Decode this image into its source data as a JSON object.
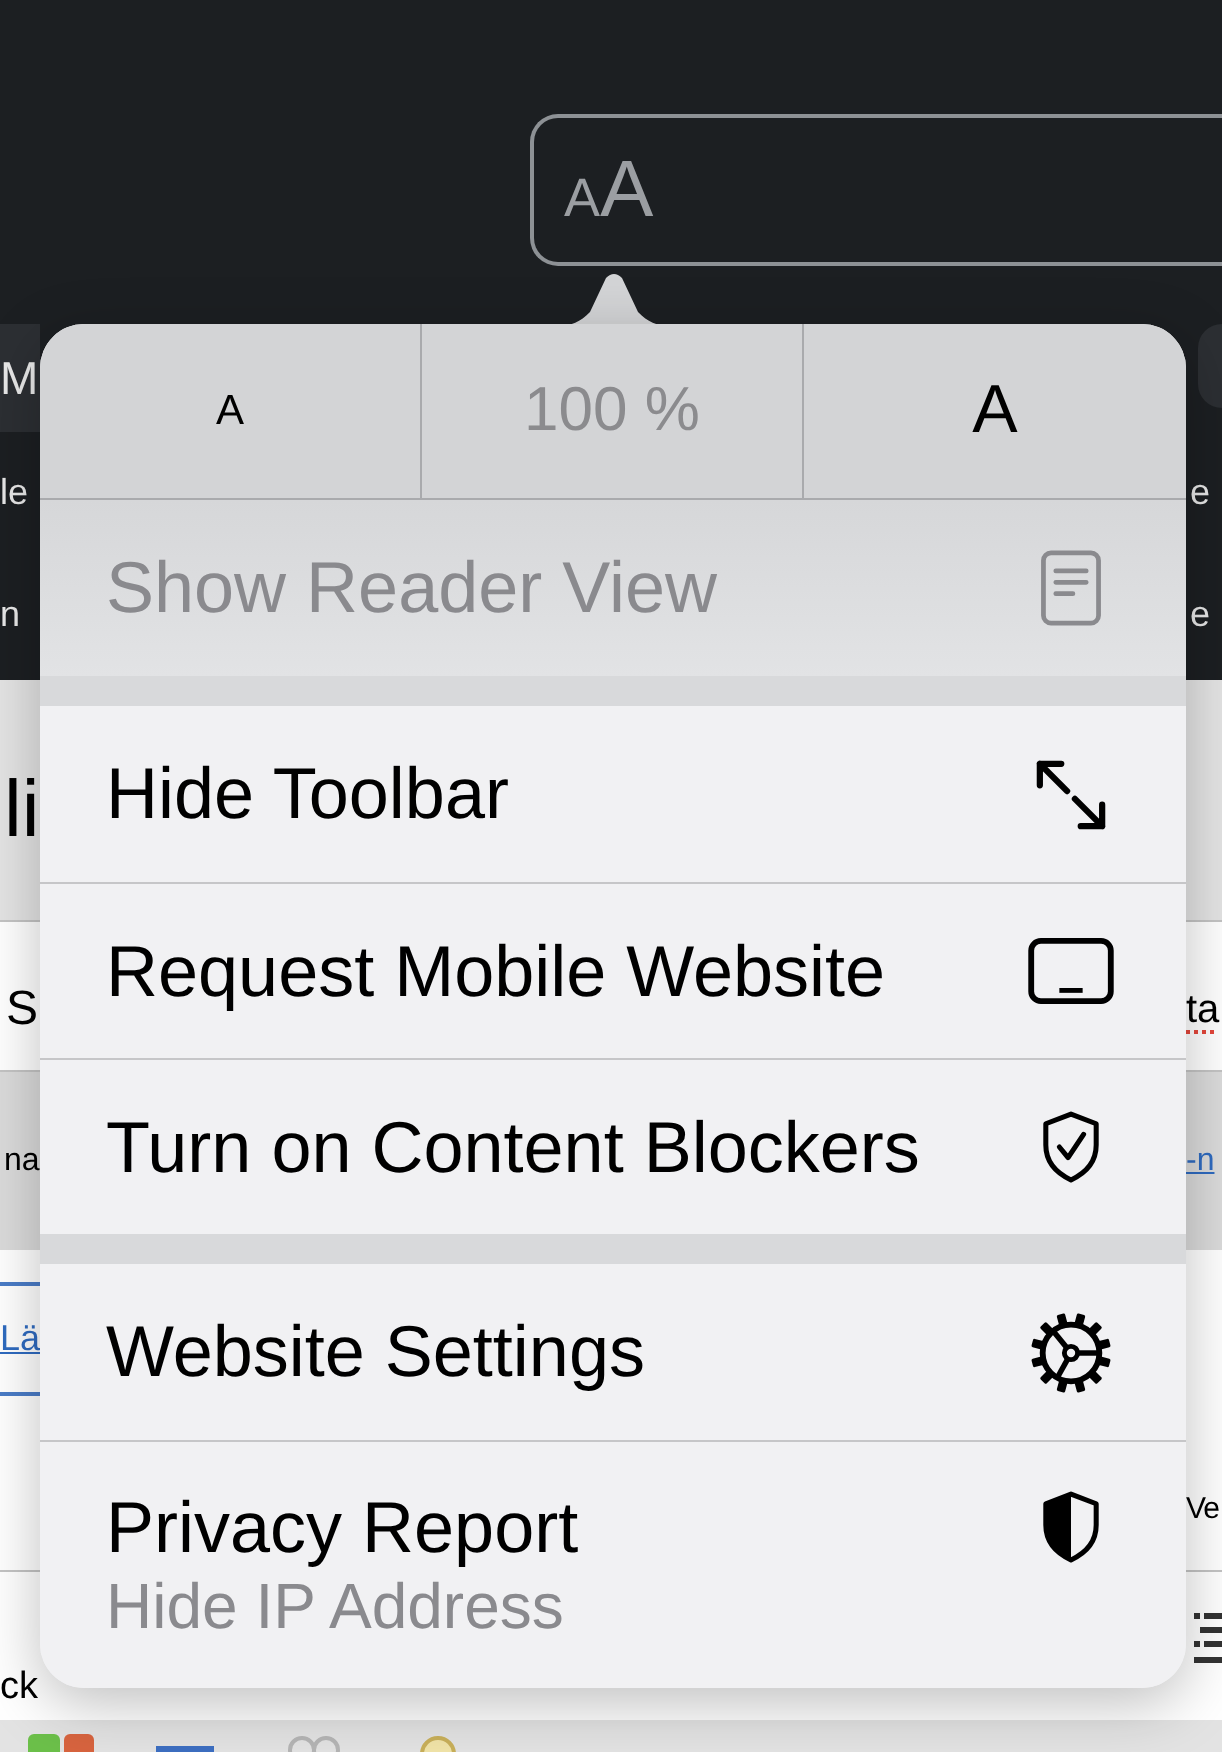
{
  "address_bar": {
    "format_button": {
      "small_letter": "A",
      "large_letter": "A"
    }
  },
  "background_rows": [
    {
      "kind": "tabs",
      "left": {
        "text": "M",
        "kind": "plain"
      }
    },
    {
      "kind": "caption",
      "left": {
        "text": "le",
        "kind": "plain"
      },
      "right": {
        "text": "e",
        "kind": "plain"
      }
    },
    {
      "kind": "caption",
      "left": {
        "text": "n",
        "kind": "plain"
      },
      "right": {
        "text": "e",
        "kind": "plain"
      }
    },
    {
      "kind": "heading",
      "left": {
        "text": "li",
        "kind": "plain"
      }
    },
    {
      "kind": "field",
      "left": {
        "text": "S",
        "kind": "plain"
      },
      "right": {
        "text": "ta",
        "kind": "misspelled"
      }
    },
    {
      "kind": "band",
      "left": {
        "text": "na",
        "kind": "plain"
      },
      "right": {
        "text": "-n",
        "kind": "link"
      }
    },
    {
      "kind": "link",
      "left": {
        "text": "Lä",
        "kind": "link"
      }
    },
    {
      "kind": "text",
      "right": {
        "text": "Ve",
        "kind": "plain"
      }
    },
    {
      "kind": "footer",
      "left": {
        "text": "ck",
        "kind": "plain"
      }
    }
  ],
  "popover": {
    "text_size": {
      "decrease": "A",
      "zoom": "100 %",
      "increase": "A"
    },
    "sections": [
      {
        "items": [
          {
            "label": "Show Reader View",
            "disabled": true
          }
        ]
      },
      {
        "items": [
          {
            "label": "Hide Toolbar",
            "disabled": false
          },
          {
            "label": "Request Mobile Website",
            "disabled": false
          },
          {
            "label": "Turn on Content Blockers",
            "disabled": false
          }
        ]
      },
      {
        "items": [
          {
            "label": "Website Settings",
            "disabled": false
          },
          {
            "label": "Privacy Report",
            "subtitle": "Hide IP Address",
            "disabled": false
          }
        ]
      }
    ]
  }
}
